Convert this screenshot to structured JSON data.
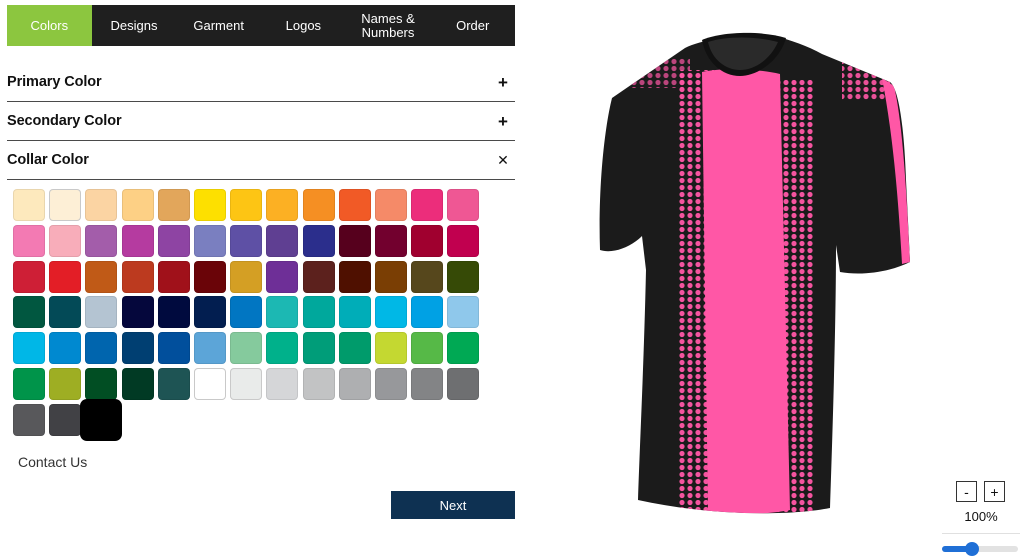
{
  "tabs": [
    {
      "label": "Colors",
      "active": true
    },
    {
      "label": "Designs",
      "active": false
    },
    {
      "label": "Garment",
      "active": false
    },
    {
      "label": "Logos",
      "active": false
    },
    {
      "label": "Names &\nNumbers",
      "active": false
    },
    {
      "label": "Order",
      "active": false
    }
  ],
  "sections": {
    "primary": {
      "label": "Primary Color",
      "icon": "plus-icon",
      "symbol": "+"
    },
    "secondary": {
      "label": "Secondary Color",
      "icon": "plus-icon",
      "symbol": "+"
    },
    "collar": {
      "label": "Collar Color",
      "icon": "close-icon",
      "symbol": "✕"
    }
  },
  "swatches": [
    "#fde9bd",
    "#fdefd6",
    "#fbd4a3",
    "#fdd085",
    "#e2a65b",
    "#fde000",
    "#fdc514",
    "#fcb023",
    "#f58f23",
    "#f15a26",
    "#f58a68",
    "#ec2d7b",
    "#ef5794",
    "#f37ab3",
    "#f8adba",
    "#a35daa",
    "#b53ba0",
    "#8e44a3",
    "#7a7fc0",
    "#5e50a5",
    "#5f3f92",
    "#2b2e8c",
    "#56001d",
    "#72002e",
    "#a0002f",
    "#c1004f",
    "#ce1f36",
    "#e31e26",
    "#c05a17",
    "#bc3a1f",
    "#a0111a",
    "#6a0408",
    "#d49f24",
    "#6e2f97",
    "#5c211d",
    "#4f1000",
    "#7a3e04",
    "#56471c",
    "#364a06",
    "#015740",
    "#034a57",
    "#b4c4d2",
    "#05073c",
    "#000a3e",
    "#021e50",
    "#0176c2",
    "#1cb8b3",
    "#00a89c",
    "#00adb8",
    "#00b8e6",
    "#00a1e4",
    "#8fc8eb",
    "#00b7e7",
    "#0089d0",
    "#0065ae",
    "#003f72",
    "#014f9c",
    "#5ca5d8",
    "#85ca9d",
    "#00b18b",
    "#009d79",
    "#009b6b",
    "#c4d831",
    "#56b947",
    "#00a954",
    "#00944a",
    "#9eae23",
    "#014e23",
    "#013a24",
    "#1e5454",
    "#ffffff",
    "#e9ebea",
    "#d5d6d8",
    "#c2c3c4",
    "#aeafb1",
    "#97989b",
    "#838486",
    "#6e6f71",
    "#58585b",
    "#414145",
    "#000000"
  ],
  "selected_swatch": "#000000",
  "contact_label": "Contact Us",
  "next_label": "Next",
  "zoom": {
    "minus": "-",
    "plus": "+",
    "level": "100%",
    "slider_fraction": 0.4
  },
  "preview": {
    "shirt_body_color": "#1b1b1b",
    "stripe_color": "#ff57a6",
    "shoulder_color": "#ff57a6"
  }
}
